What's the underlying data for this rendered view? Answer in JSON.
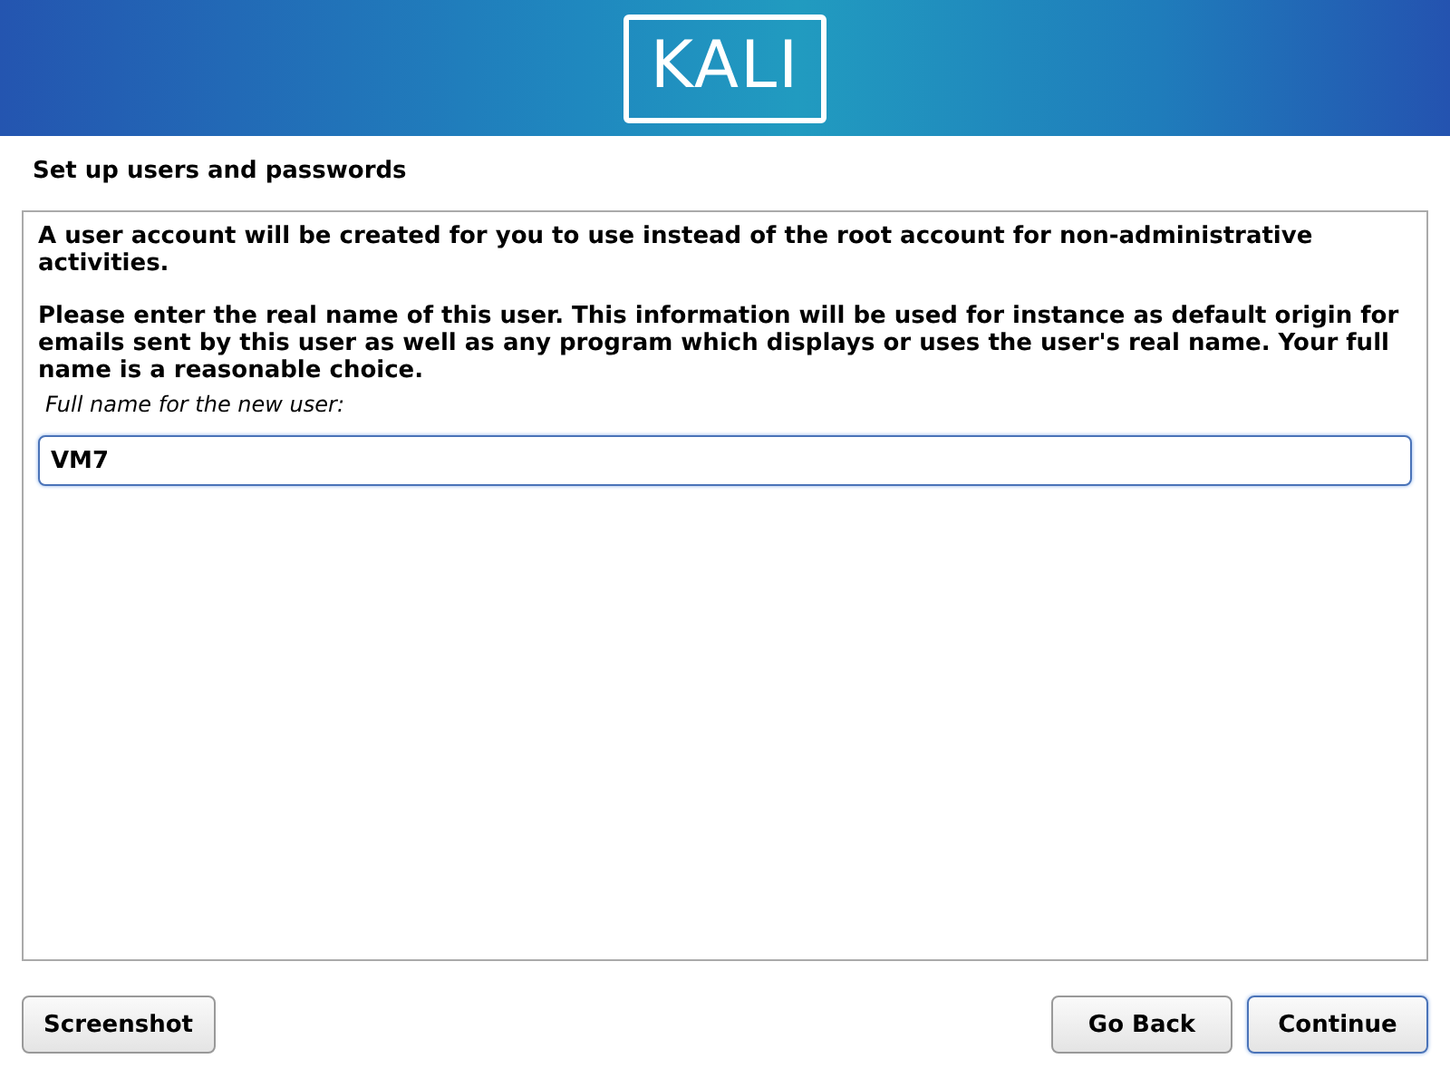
{
  "banner": {
    "logo": "KALI"
  },
  "title": "Set up users and passwords",
  "panel": {
    "paragraphs": [
      "A user account will be created for you to use instead of the root account for non-administrative activities.",
      "Please enter the real name of this user. This information will be used for instance as default origin for emails sent by this user as well as any program which displays or uses the user's real name. Your full name is a reasonable choice."
    ],
    "field": {
      "label": "Full name for the new user:",
      "value": "VM7"
    }
  },
  "buttons": [
    {
      "label": "Screenshot",
      "focused": false
    },
    {
      "label": "Go Back",
      "focused": false
    },
    {
      "label": "Continue",
      "focused": true
    }
  ]
}
